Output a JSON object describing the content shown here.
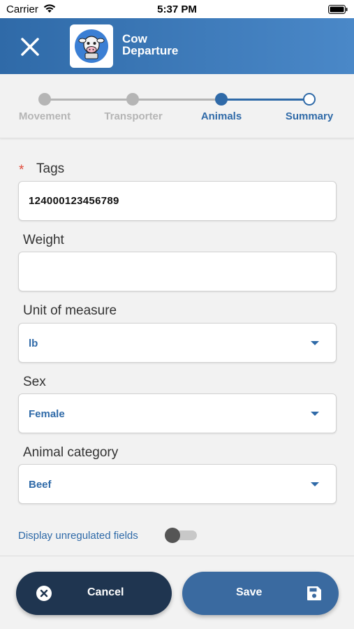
{
  "status_bar": {
    "carrier": "Carrier",
    "time": "5:37 PM"
  },
  "header": {
    "title_line1": "Cow",
    "title_line2": "Departure",
    "close_icon": "close-icon",
    "logo": "cow-logo"
  },
  "stepper": {
    "steps": [
      {
        "label": "Movement",
        "state": "completed"
      },
      {
        "label": "Transporter",
        "state": "completed"
      },
      {
        "label": "Animals",
        "state": "active"
      },
      {
        "label": "Summary",
        "state": "upcoming"
      }
    ],
    "colors": {
      "completed": "#b5b5b5",
      "active": "#2f6aa8"
    }
  },
  "form": {
    "tags": {
      "label": "Tags",
      "required": true,
      "value": "124000123456789"
    },
    "weight": {
      "label": "Weight",
      "value": ""
    },
    "unit": {
      "label": "Unit of measure",
      "value": "lb"
    },
    "sex": {
      "label": "Sex",
      "value": "Female"
    },
    "category": {
      "label": "Animal category",
      "value": "Beef"
    },
    "unregulated": {
      "label": "Display unregulated fields",
      "on": false
    }
  },
  "footer": {
    "cancel_label": "Cancel",
    "save_label": "Save"
  },
  "colors": {
    "header_start": "#2f6aa8",
    "header_end": "#4a88c8",
    "accent": "#2f6aa8",
    "cancel_bg": "#1f3550",
    "save_bg": "#3a6aa0",
    "required": "#e04a3a"
  }
}
